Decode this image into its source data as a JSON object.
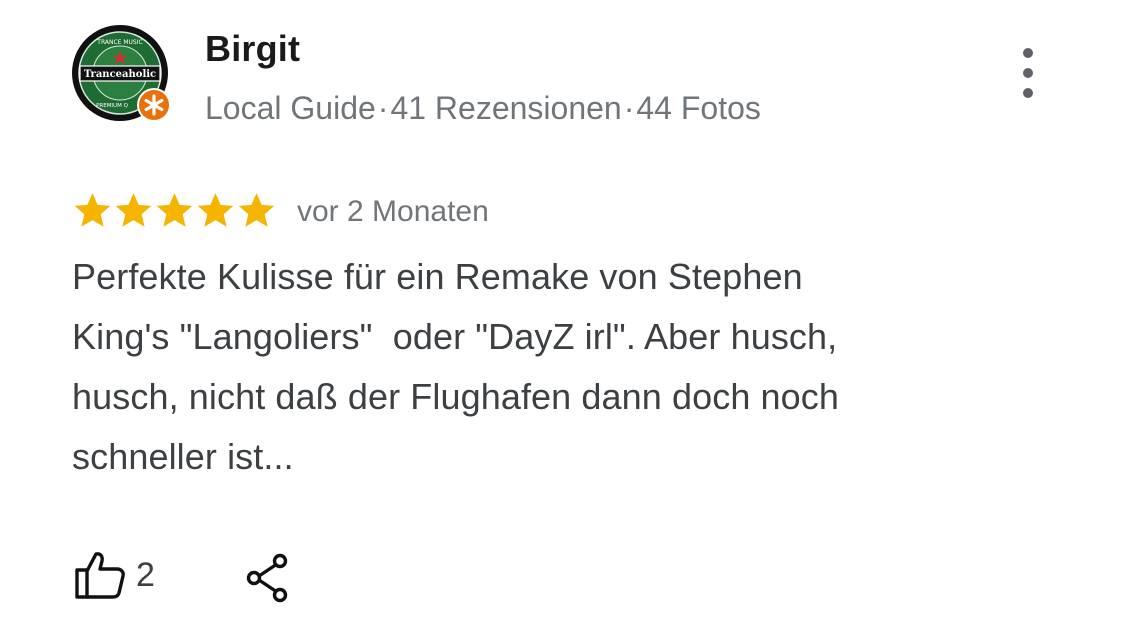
{
  "author": {
    "name": "Birgit",
    "badge": "Local Guide",
    "reviews": "41 Rezensionen",
    "photos": "44 Fotos",
    "separator": "·",
    "avatar_icon": "tranceaholic-logo-icon",
    "avatar_logo_text": "Tranceaholic",
    "avatar_ring_text_top": "TRANCE MUSIC",
    "avatar_ring_text_bottom": "PREMIUM Q"
  },
  "review": {
    "rating": 5,
    "rating_max": 5,
    "date": "vor 2 Monaten",
    "text": "Perfekte Kulisse für ein Remake von Stephen\nKing's \"Langoliers\"  oder \"DayZ irl\". Aber husch,\nhusch, nicht daß der Flughafen dann doch noch\nschneller ist..."
  },
  "actions": {
    "like_count": "2",
    "like_icon": "thumbs-up-icon",
    "share_icon": "share-icon",
    "more_icon": "more-vert-icon"
  },
  "colors": {
    "star": "#f4b400",
    "badge": "#e8710a",
    "logo_green": "#1e6b34",
    "text_primary": "#1a1a1a",
    "text_secondary": "#70757a"
  }
}
